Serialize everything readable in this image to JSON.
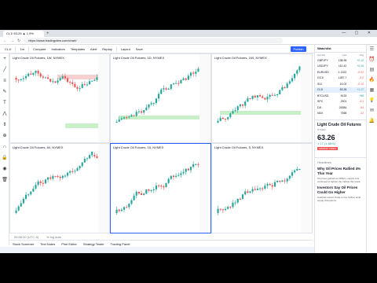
{
  "browser": {
    "tab_title": "CL1! 63.26 ▲ 1.9%",
    "url": "https://www.tradingview.com/chart/",
    "window_controls": "— ▢ ✕"
  },
  "toolbar": {
    "items": [
      "CL1!",
      "1m",
      "Compare",
      "Indicators",
      "Templates",
      "Alert",
      "Replay",
      "Layout",
      "Save"
    ],
    "publish_label": "Publish"
  },
  "panes": [
    {
      "label": "Light Crude Oil Futures, 1W, NYMEX",
      "trend": "down"
    },
    {
      "label": "Light Crude Oil Futures, 1D, NYMEX",
      "trend": "up"
    },
    {
      "label": "Light Crude Oil Futures, 240, NYMEX",
      "trend": "up"
    },
    {
      "label": "Light Crude Oil Futures, 60, NYMEX",
      "trend": "up"
    },
    {
      "label": "Light Crude Oil Futures, 15, NYMEX",
      "trend": "up"
    },
    {
      "label": "Light Crude Oil Futures, 5, NYMEX",
      "trend": "up"
    }
  ],
  "bottom_bar": {
    "time": "09:56:00 (UTC-5)",
    "extra": "% log auto"
  },
  "panel_bar": {
    "items": [
      "Stock Screener",
      "Text Notes",
      "Pine Editor",
      "Strategy Tester",
      "Trading Panel"
    ]
  },
  "watchlist": {
    "title": "Watchlist",
    "columns": [
      "Symbol",
      "Last",
      "Chg"
    ],
    "rows": [
      {
        "sym": "GBPJPY",
        "last": "138.95",
        "chg": "+0.12",
        "dir": "up"
      },
      {
        "sym": "USDJPY",
        "last": "110.42",
        "chg": "+0.05",
        "dir": "up"
      },
      {
        "sym": "EURUSD",
        "last": "1.1322",
        "chg": "-0.02",
        "dir": "dn"
      },
      {
        "sym": "GC1!",
        "last": "1287.7",
        "chg": "-3.2",
        "dir": "dn"
      },
      {
        "sym": "SI1!",
        "last": "15.02",
        "chg": "-0.10",
        "dir": "dn"
      },
      {
        "sym": "CL1!",
        "last": "63.26",
        "chg": "+1.17",
        "dir": "up",
        "hl": true
      },
      {
        "sym": "BTCUSD",
        "last": "5133",
        "chg": "+88",
        "dir": "up"
      },
      {
        "sym": "SPX",
        "last": "2901",
        "chg": "-4.1",
        "dir": "dn"
      },
      {
        "sym": "DJI",
        "last": "26384",
        "chg": "-54",
        "dir": "dn"
      },
      {
        "sym": "NDX",
        "last": "7558",
        "chg": "-12",
        "dir": "dn"
      }
    ]
  },
  "details": {
    "title": "Light Crude Oil Futures",
    "exchange": "NYMEX",
    "price": "63.26",
    "change": "1.17 (1.88%)",
    "badge": "MARKET OPEN"
  },
  "news": {
    "header": "Headlines",
    "items": [
      {
        "title": "Why Oil Prices Rallied 4% This Year",
        "body": "Oil prices gained as OPEC+ supply cuts continued to tighten the market this week."
      },
      {
        "title": "Investors Say Oil Prices Could Go Higher",
        "body": "Analysts expect crude to rise further amid supply disruptions."
      }
    ]
  },
  "colors": {
    "accent": "#2962ff",
    "up": "#26a69a",
    "down": "#ef5350",
    "green_zone": "#c8f0c8",
    "red_zone": "#f8d0d0"
  }
}
